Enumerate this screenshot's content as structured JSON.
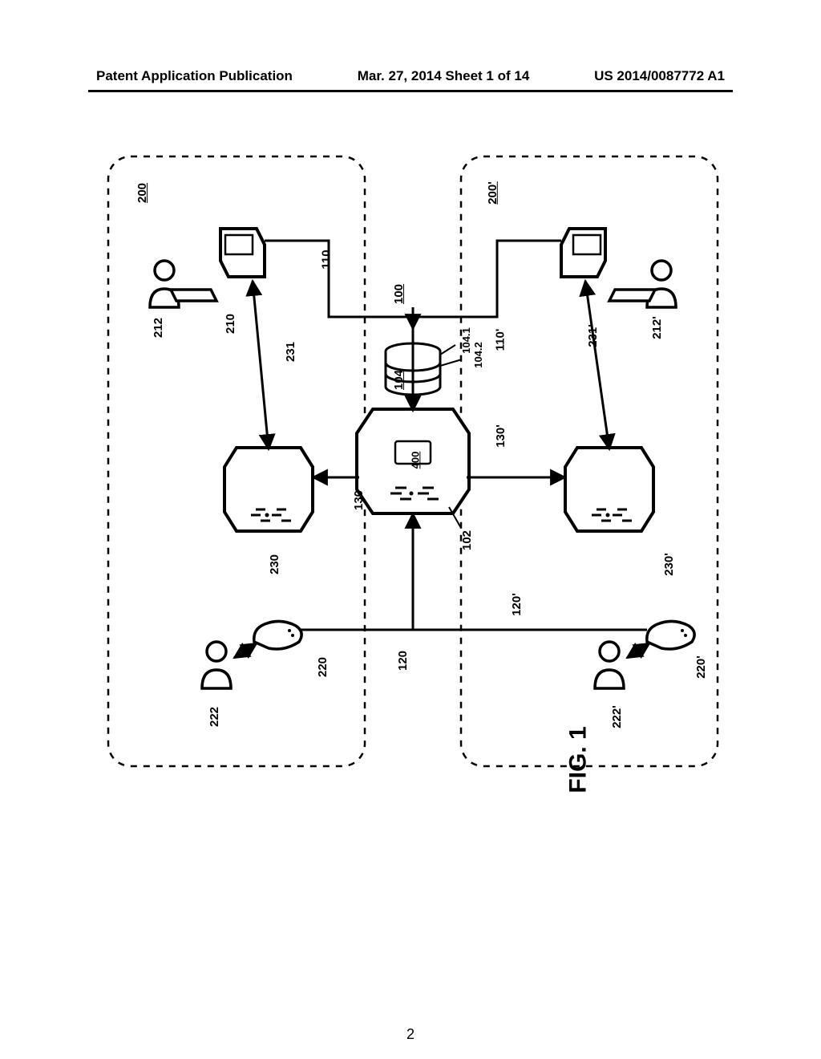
{
  "header": {
    "left": "Patent Application Publication",
    "center": "Mar. 27, 2014  Sheet 1 of 14",
    "right": "US 2014/0087772 A1"
  },
  "figure": {
    "label": "FIG. 1"
  },
  "refs": {
    "r200": "200",
    "r200p": "200'",
    "r100": "100",
    "r212": "212",
    "r212p": "212'",
    "r210": "210",
    "r231": "231",
    "r231p": "231'",
    "r230": "230",
    "r230p": "230'",
    "r222": "222",
    "r222p": "222'",
    "r220": "220",
    "r220p": "220'",
    "r110": "110",
    "r110p": "110'",
    "r120": "120",
    "r120p": "120'",
    "r130": "130",
    "r130p": "130'",
    "r104": "104",
    "r104_1": "104.1",
    "r104_2": "104.2",
    "r400": "400",
    "r102": "102"
  }
}
